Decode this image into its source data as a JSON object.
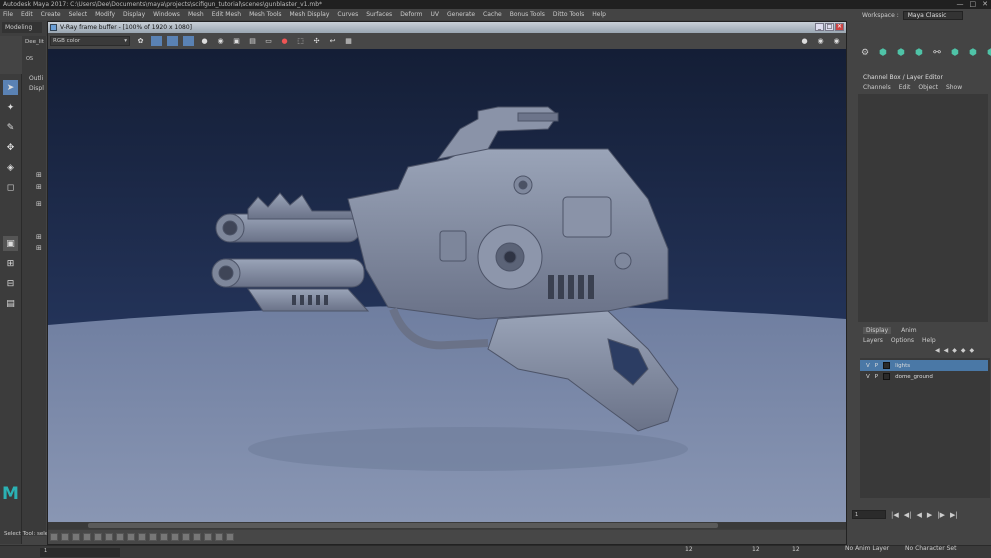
{
  "app": {
    "title": "Autodesk Maya 2017: C:\\Users\\Dee\\Documents\\maya\\projects\\scifigun_tutorial\\scenes\\gunblaster_v1.mb*",
    "window_buttons": [
      "—",
      "□",
      "✕"
    ]
  },
  "menu": [
    "File",
    "Edit",
    "Create",
    "Select",
    "Modify",
    "Display",
    "Windows",
    "Mesh",
    "Edit Mesh",
    "Mesh Tools",
    "Mesh Display",
    "Curves",
    "Surfaces",
    "Deform",
    "UV",
    "Generate",
    "Cache",
    "Bonus Tools",
    "Ditto Tools",
    "Help"
  ],
  "workspace": {
    "label": "Workspace :",
    "value": "Maya Classic"
  },
  "mode_menu": "Modeling",
  "outliner": {
    "title": "Outli",
    "display": "Displ",
    "item": "Dee_lit",
    "item2": "OS"
  },
  "shelf_icons": [
    "shelf-icon-1",
    "shelf-icon-2",
    "shelf-icon-3",
    "shelf-icon-4",
    "shelf-icon-5",
    "shelf-icon-6",
    "shelf-icon-7",
    "shelf-icon-8"
  ],
  "channel_box": {
    "title": "Channel Box / Layer Editor",
    "menu": [
      "Channels",
      "Edit",
      "Object",
      "Show"
    ]
  },
  "layer_editor": {
    "tabs": [
      "Display",
      "Anim"
    ],
    "menu": [
      "Layers",
      "Options",
      "Help"
    ],
    "layers": [
      {
        "v": "V",
        "p": "P",
        "name": "lights",
        "selected": true
      },
      {
        "v": "V",
        "p": "P",
        "name": "dome_ground",
        "selected": false
      }
    ]
  },
  "time": {
    "frame": "1",
    "controls": [
      "|◀",
      "◀|",
      "◀",
      "▶",
      "|▶",
      "▶|"
    ]
  },
  "status": {
    "text": "Select Tool: sele",
    "field": "1",
    "anim_layer": "No Anim Layer",
    "character_set": "No Character Set",
    "end1": "12",
    "end2": "12",
    "end3": "12"
  },
  "vfb": {
    "title": "V-Ray frame buffer - [100% of 1920 x 1080]",
    "channel": "RGB color",
    "controls": [
      "_",
      "□",
      "✕"
    ]
  },
  "colors": {
    "accent": "#5a82b4",
    "maya_teal": "#2bb1b3",
    "layer_select": "#4a78a6"
  }
}
